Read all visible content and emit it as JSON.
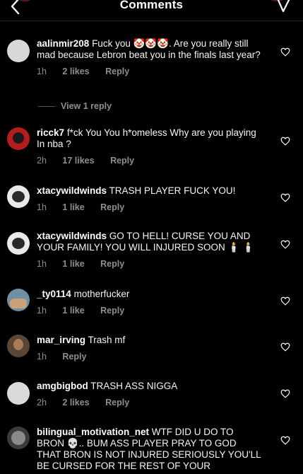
{
  "header": {
    "title": "Comments"
  },
  "comments": [
    {
      "user": "aalinmir208",
      "text": "Fuck you 🤡🤡🤡. Are you really still mad because Lebron beat you in the finals last year?",
      "time": "1h",
      "likes": "2 likes",
      "reply": "Reply",
      "view_replies": "View 1 reply"
    },
    {
      "user": "ricck7",
      "text": "f*ck You You h*omeless Why are you playing In nba ?",
      "time": "2h",
      "likes": "17 likes",
      "reply": "Reply"
    },
    {
      "user": "xtacywildwinds",
      "text": "TRASH PLAYER FUCK YOU!",
      "time": "1h",
      "likes": "1 like",
      "reply": "Reply"
    },
    {
      "user": "xtacywildwinds",
      "text": "GO TO HELL! CURSE YOU AND YOUR FAMILY! YOU WILL INJURED SOON 🕯️ 🕯️",
      "time": "1h",
      "likes": "1 like",
      "reply": "Reply"
    },
    {
      "user": "_ty0114",
      "text": "motherfucker",
      "time": "1h",
      "likes": "1 like",
      "reply": "Reply"
    },
    {
      "user": "mar_irving",
      "text": "Trash mf",
      "time": "1h",
      "likes": "",
      "reply": "Reply"
    },
    {
      "user": "amgbigbod",
      "text": "TRASH ASS NIGGA",
      "time": "2h",
      "likes": "2 likes",
      "reply": "Reply"
    },
    {
      "user": "bilingual_motivation_net",
      "text": "WTF DID U DO TO BRON 💀.. BUM ASS PLAYER PRAY TO GOD THAT BRON IS NOT INJURED SERIOUSLY YOU'LL BE CURSED FOR THE REST OF YOUR",
      "time": "",
      "likes": "",
      "reply": ""
    }
  ],
  "icons": {
    "back": "chevron-left-icon",
    "send": "send-icon",
    "heart": "heart-outline-icon"
  }
}
